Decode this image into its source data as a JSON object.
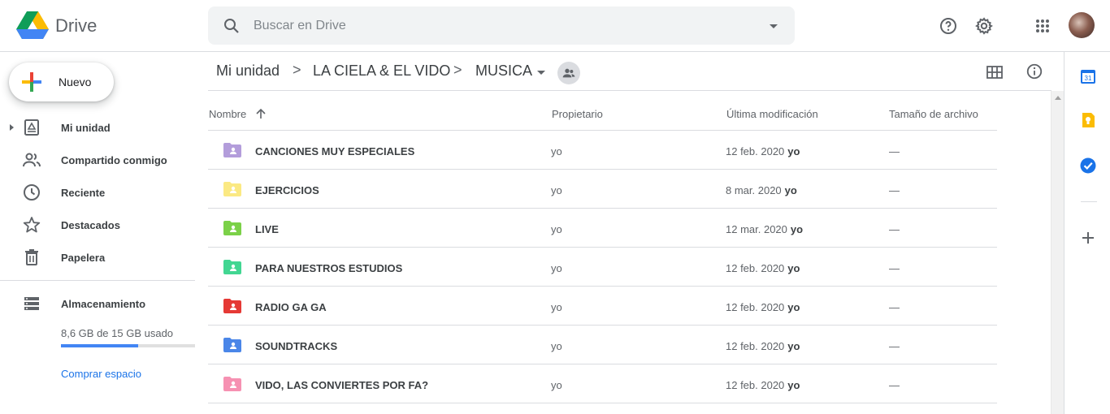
{
  "app": {
    "title": "Drive"
  },
  "search": {
    "placeholder": "Buscar en Drive"
  },
  "sidebar": {
    "new_label": "Nuevo",
    "items": [
      {
        "label": "Mi unidad"
      },
      {
        "label": "Compartido conmigo"
      },
      {
        "label": "Reciente"
      },
      {
        "label": "Destacados"
      },
      {
        "label": "Papelera"
      }
    ],
    "storage": {
      "label": "Almacenamiento",
      "usage": "8,6 GB de 15 GB usado",
      "fraction_used": 0.573,
      "buy_label": "Comprar espacio"
    }
  },
  "breadcrumb": {
    "items": [
      "Mi unidad",
      "LA CIELA & EL VIDO",
      "MUSICA"
    ],
    "separator": ">"
  },
  "table": {
    "headers": {
      "name": "Nombre",
      "owner": "Propietario",
      "modified": "Última modificación",
      "size": "Tamaño de archivo"
    },
    "rows": [
      {
        "name": "CANCIONES MUY ESPECIALES",
        "owner": "yo",
        "date": "12 feb. 2020",
        "modified_by": "yo",
        "size": "—",
        "color": "#b39ddb"
      },
      {
        "name": "EJERCICIOS",
        "owner": "yo",
        "date": "8 mar. 2020",
        "modified_by": "yo",
        "size": "—",
        "color": "#fbe983"
      },
      {
        "name": "LIVE",
        "owner": "yo",
        "date": "12 mar. 2020",
        "modified_by": "yo",
        "size": "—",
        "color": "#7bd148"
      },
      {
        "name": "PARA NUESTROS ESTUDIOS",
        "owner": "yo",
        "date": "12 feb. 2020",
        "modified_by": "yo",
        "size": "—",
        "color": "#42d692"
      },
      {
        "name": "RADIO GA GA",
        "owner": "yo",
        "date": "12 feb. 2020",
        "modified_by": "yo",
        "size": "—",
        "color": "#e53935"
      },
      {
        "name": "SOUNDTRACKS",
        "owner": "yo",
        "date": "12 feb. 2020",
        "modified_by": "yo",
        "size": "—",
        "color": "#4a86e8"
      },
      {
        "name": "VIDO, LAS CONVIERTES POR FA?",
        "owner": "yo",
        "date": "12 feb. 2020",
        "modified_by": "yo",
        "size": "—",
        "color": "#f691b2"
      }
    ]
  },
  "side_panel": {
    "calendar_day": "31"
  },
  "colors": {
    "accent": "#1a73e8",
    "storage_bar": "#4285f4",
    "divider": "#dadce0"
  }
}
